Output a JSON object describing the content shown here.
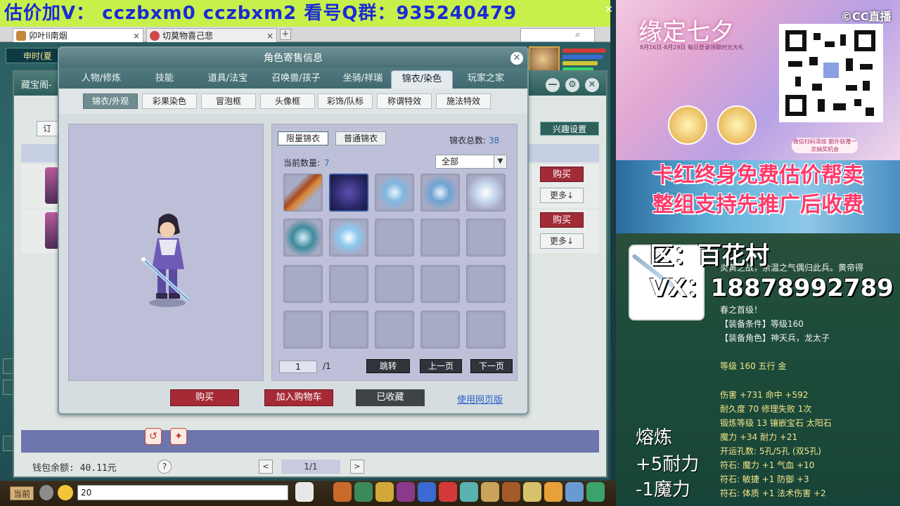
{
  "banner": {
    "text": "估价加V：  cczbxm0    cczbxm2    看号Q群：935240479"
  },
  "browser": {
    "tabs": [
      {
        "label": "卯叶ll南烟"
      },
      {
        "label": "切莫物喜己悲"
      }
    ],
    "add_tab": "+",
    "close": "×"
  },
  "game": {
    "status": "申时(夏"
  },
  "shop": {
    "title": "藏宝阁-",
    "order_label": "订",
    "interest_label": "兴趣设置",
    "buy_label": "购买",
    "more_label": "更多↓",
    "wallet": "钱包余额: 40.11元",
    "page": "1/1",
    "help": "?",
    "prev": "<",
    "next": ">",
    "min": "—",
    "settings": "⚙",
    "close": "✕"
  },
  "dialog": {
    "title": "角色寄售信息",
    "close": "✕",
    "tabs": [
      "人物/修炼",
      "技能",
      "道具/法宝",
      "召唤兽/孩子",
      "坐骑/祥瑞",
      "锦衣/染色",
      "玩家之家"
    ],
    "active_tab": 5,
    "subtabs": [
      "锦衣/外观",
      "彩果染色",
      "冒泡框",
      "头像框",
      "彩饰/队标",
      "称谓特效",
      "施法特效"
    ],
    "active_subtab": 0,
    "inventory": {
      "tab_limited": "限量锦衣",
      "tab_normal": "普通锦衣",
      "total_label": "锦衣总数:",
      "total_value": "38",
      "count_label": "当前数量:",
      "count_value": "7",
      "filter": "全部",
      "page_current": "1",
      "page_total": "/1",
      "jump": "跳转",
      "prev_page": "上一页",
      "next_page": "下一页"
    },
    "actions": {
      "buy": "购买",
      "add_cart": "加入购物车",
      "favorited": "已收藏",
      "web_version": "使用网页版"
    }
  },
  "chat": {
    "channel": "当前",
    "input_value": "20"
  },
  "stream": {
    "promo_title": "缘定七夕",
    "promo_sub": "8月16日-8月29日 每日登录领取时光大礼",
    "promo_note": "微信扫码添加\n额外获赠一次抽奖机会",
    "cc_logo": "©CC直播",
    "slogan1": "卡红终身免费估价帮卖",
    "slogan2": "整组支持先推广后收费",
    "area": "区：百花村",
    "vx": "VX：18878992789",
    "desc1": "炎黄之战，余温之气偶归此兵。黄帝得",
    "desc2": "春之首级！",
    "props": [
      "【装备条件】等级160",
      "【装备角色】神天兵，龙太子",
      "等级 160 五行 金",
      "伤害 +731 命中 +592",
      "耐久度 70 修理失败 1次",
      "锻炼等级 13 镶嵌宝石 太阳石",
      "魔力 +34 耐力 +21",
      "开运孔数: 5孔/5孔 (双5孔)",
      "符石: 魔力 +1 气血 +10",
      "符石: 敏捷 +1 防御 +3",
      "符石: 体质 +1 法术伤害 +2"
    ],
    "smelt_title": "熔炼",
    "smelt_1": "+5耐力",
    "smelt_2": "-1魔力"
  },
  "colors": {
    "banner_bg": "#c8f04a",
    "banner_text": "#1a2bd6",
    "buy_red": "#a12b37",
    "slogan_pink": "#ff3a6b"
  }
}
